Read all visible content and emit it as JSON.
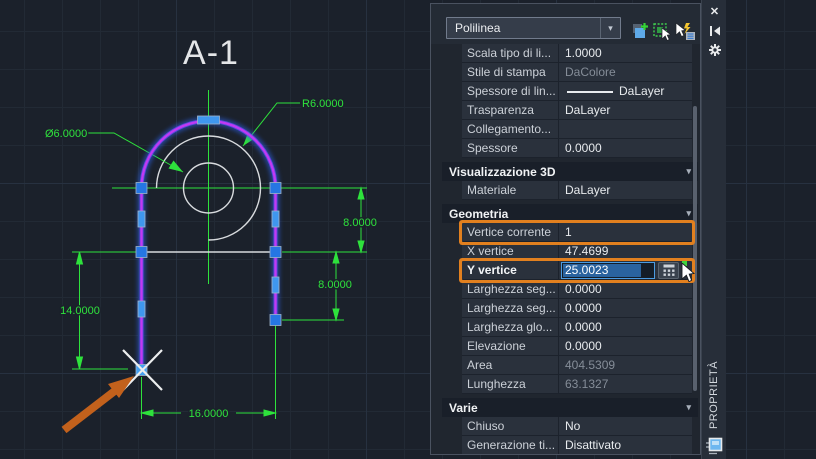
{
  "drawing": {
    "title": "A-1",
    "radius_label": "R6.0000",
    "diameter_label": "Ø6.0000",
    "height_top_label": "8.0000",
    "height_bottom_label": "8.0000",
    "height_left_label": "14.0000",
    "width_label": "16.0000",
    "colors": {
      "dimension_green": "#2ee23c",
      "polyline_core": "#c23af2",
      "polyline_glow": "#2b63e8",
      "grip_blue": "#2576e3",
      "annotation_arrow_orange": "#c2611c",
      "geometry_white": "#d8dbde"
    }
  },
  "panel": {
    "type_selector": "Polilinea",
    "dropdown_caret": "▾",
    "section_caret": "▾",
    "sidebar_title": "PROPRIETÀ",
    "close_glyph": "✕",
    "highlight_color": "#e2801f",
    "sections": [
      {
        "header": "",
        "rows": [
          {
            "label": "Scala tipo di li...",
            "value": "1.0000"
          },
          {
            "label": "Stile di stampa",
            "value": "DaColore",
            "readonly": true
          },
          {
            "label": "Spessore di lin...",
            "value": "DaLayer",
            "type": "lineweight"
          },
          {
            "label": "Trasparenza",
            "value": "DaLayer"
          },
          {
            "label": "Collegamento...",
            "value": ""
          },
          {
            "label": "Spessore",
            "value": "0.0000"
          }
        ]
      },
      {
        "header": "Visualizzazione 3D",
        "rows": [
          {
            "label": "Materiale",
            "value": "DaLayer"
          }
        ]
      },
      {
        "header": "Geometria",
        "rows": [
          {
            "label": "Vertice corrente",
            "value": "1",
            "highlight": true
          },
          {
            "label": "X vertice",
            "value": "47.4699"
          },
          {
            "label": "Y vertice",
            "value": "25.0023",
            "type": "input",
            "highlight": true,
            "bold": true
          },
          {
            "label": "Larghezza seg...",
            "value": "0.0000"
          },
          {
            "label": "Larghezza seg...",
            "value": "0.0000"
          },
          {
            "label": "Larghezza glo...",
            "value": "0.0000"
          },
          {
            "label": "Elevazione",
            "value": "0.0000"
          },
          {
            "label": "Area",
            "value": "404.5309",
            "readonly": true
          },
          {
            "label": "Lunghezza",
            "value": "63.1327",
            "readonly": true
          }
        ]
      },
      {
        "header": "Varie",
        "rows": [
          {
            "label": "Chiuso",
            "value": "No"
          },
          {
            "label": "Generazione  ti...",
            "value": "Disattivato"
          }
        ]
      }
    ]
  }
}
